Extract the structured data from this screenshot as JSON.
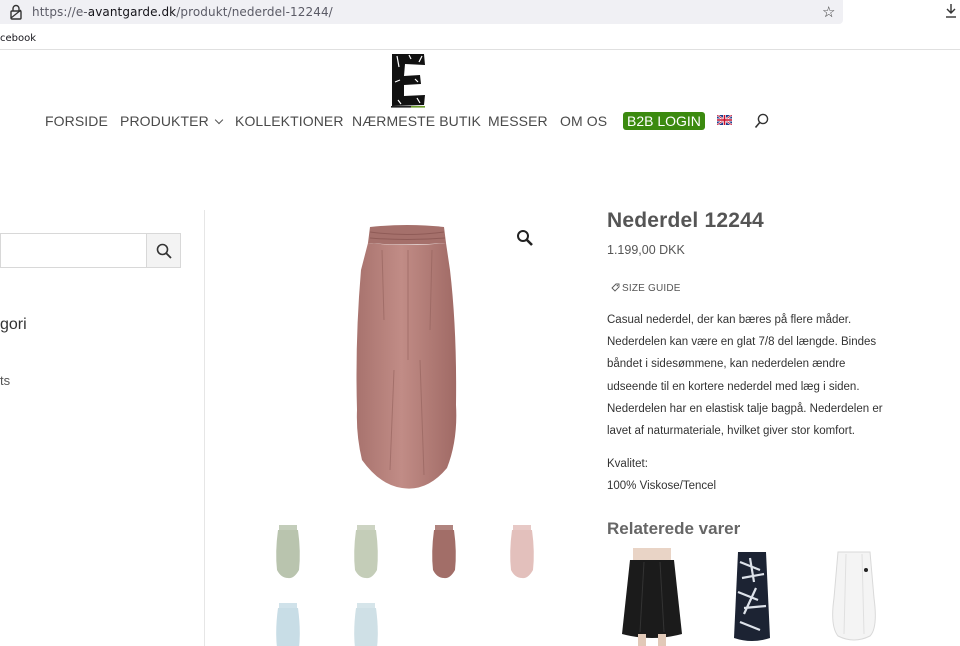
{
  "browser": {
    "url_prefix": "https://e-",
    "url_host": "avantgarde.dk",
    "url_path": "/produkt/nederdel-12244/",
    "bookmark": "cebook"
  },
  "nav": {
    "items": [
      {
        "label": "FORSIDE"
      },
      {
        "label": "PRODUKTER"
      },
      {
        "label": "KOLLEKTIONER"
      },
      {
        "label": "NÆRMESTE BUTIK"
      },
      {
        "label": "MESSER"
      },
      {
        "label": "OM OS"
      }
    ],
    "b2b_label": "B2B LOGIN"
  },
  "sidebar": {
    "category_heading": "gori",
    "sub_item": "ts"
  },
  "product": {
    "title": "Nederdel 12244",
    "price": "1.199,00 DKK",
    "size_guide": "SIZE GUIDE",
    "description": [
      "Casual nederdel, der kan bæres på flere måder.",
      "Nederdelen kan være en glat 7/8 del længde. Bindes",
      "båndet i sidesømmene, kan nederdelen ændre",
      "udseende til en kortere nederdel med læg i siden.",
      "Nederdelen har en elastisk talje bagpå. Nederdelen er",
      "lavet af naturmateriale, hvilket giver stor komfort."
    ],
    "quality_label": "Kvalitet:",
    "quality_value": "100% Viskose/Tencel"
  },
  "gallery": {
    "thumbnails": [
      {
        "color": "#b9c4ae"
      },
      {
        "color": "#c4cdb8"
      },
      {
        "color": "#a26e68"
      },
      {
        "color": "#e3c0bc"
      },
      {
        "color": "#c8dde6"
      },
      {
        "color": "#cfe0e6"
      }
    ],
    "main_color": "#b98580"
  },
  "related": {
    "heading": "Relaterede varer"
  },
  "colors": {
    "b2b": "#3b8a0f",
    "text": "#333333"
  }
}
